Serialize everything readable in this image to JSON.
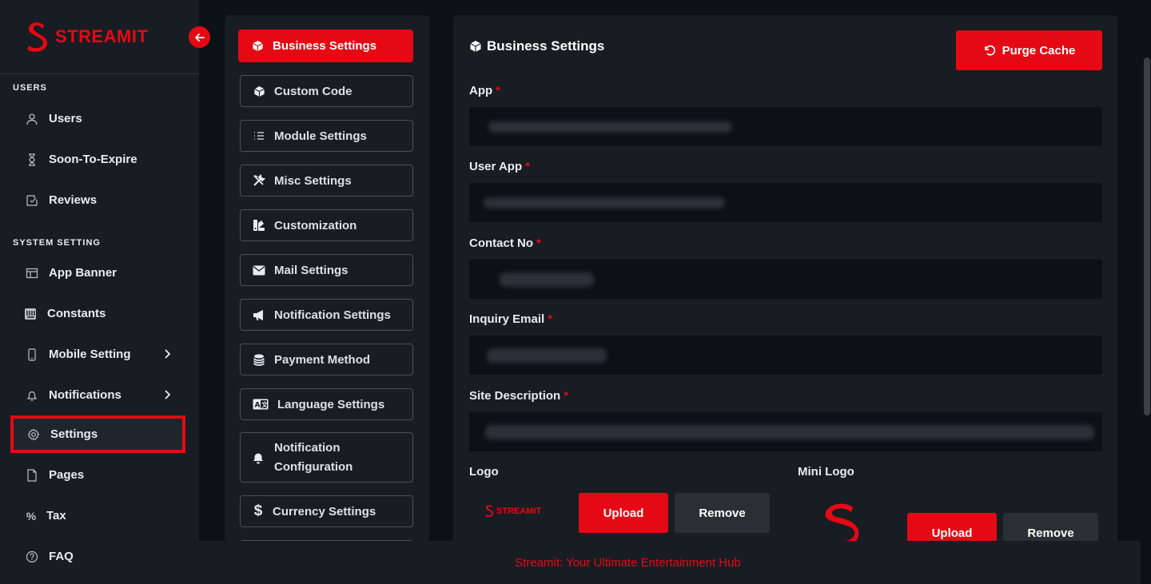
{
  "brand": {
    "name": "STREAMIT"
  },
  "sidebar": {
    "sections": [
      {
        "title": "USERS"
      },
      {
        "title": "SYSTEM SETTING"
      }
    ],
    "users_items": [
      {
        "label": "Users",
        "icon": "user-icon"
      },
      {
        "label": "Soon-To-Expire",
        "icon": "hourglass-icon"
      },
      {
        "label": "Reviews",
        "icon": "review-icon"
      }
    ],
    "system_items": [
      {
        "label": "App Banner",
        "icon": "banner-icon"
      },
      {
        "label": "Constants",
        "icon": "constants-icon"
      },
      {
        "label": "Mobile Setting",
        "icon": "mobile-icon"
      },
      {
        "label": "Notifications",
        "icon": "bell-icon"
      },
      {
        "label": "Settings",
        "icon": "gear-icon"
      },
      {
        "label": "Pages",
        "icon": "page-icon"
      },
      {
        "label": "Tax",
        "icon": "percent-icon"
      },
      {
        "label": "FAQ",
        "icon": "question-icon"
      }
    ]
  },
  "settings_menu": [
    {
      "label": "Business Settings",
      "icon": "cube-icon"
    },
    {
      "label": "Custom Code",
      "icon": "cube-icon"
    },
    {
      "label": "Module Settings",
      "icon": "list-icon"
    },
    {
      "label": "Misc Settings",
      "icon": "tools-icon"
    },
    {
      "label": "Customization",
      "icon": "palette-icon"
    },
    {
      "label": "Mail Settings",
      "icon": "envelope-icon"
    },
    {
      "label": "Notification Settings",
      "icon": "megaphone-icon"
    },
    {
      "label": "Payment Method",
      "icon": "coins-icon"
    },
    {
      "label": "Language Settings",
      "icon": "language-icon"
    },
    {
      "label": "Notification Configuration",
      "icon": "bell-icon"
    },
    {
      "label": "Currency Settings",
      "icon": "dollar-icon"
    }
  ],
  "form": {
    "title": "Business Settings",
    "purge_label": "Purge Cache",
    "fields": [
      {
        "label": "App",
        "required": "*"
      },
      {
        "label": "User App",
        "required": "*"
      },
      {
        "label": "Contact No",
        "required": "*"
      },
      {
        "label": "Inquiry Email",
        "required": "*"
      },
      {
        "label": "Site Description",
        "required": "*"
      }
    ],
    "logo_label": "Logo",
    "mini_logo_label": "Mini Logo",
    "upload_label": "Upload",
    "remove_label": "Remove",
    "logo_preview_text": "STREAMIT"
  },
  "footer": {
    "text": "Streamit: Your Ultimate Entertainment Hub"
  },
  "colors": {
    "accent": "#e50914",
    "background": "#0b1117",
    "panel": "#181d23"
  }
}
